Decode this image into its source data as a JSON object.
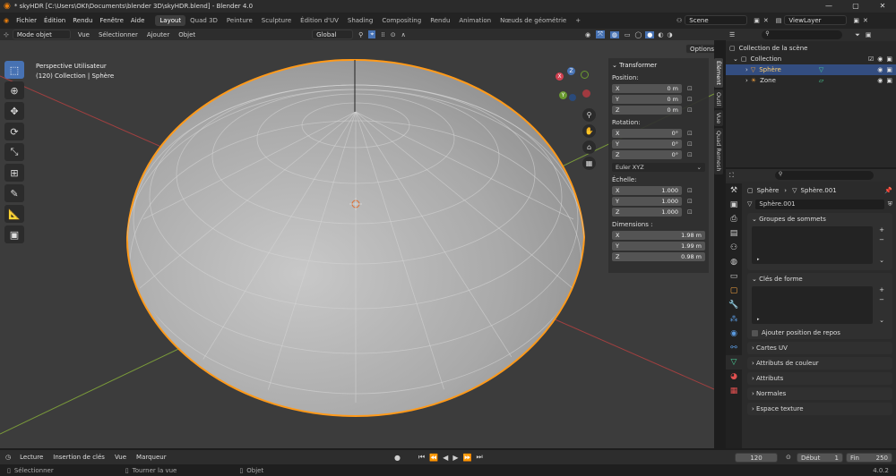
{
  "title_bar": {
    "title": "* skyHDR [C:\\Users\\OKI\\Documents\\blender 3D\\skyHDR.blend] - Blender 4.0",
    "minimize": "—",
    "maximize": "▢",
    "close": "✕"
  },
  "menu": {
    "items": [
      "Fichier",
      "Édition",
      "Rendu",
      "Fenêtre",
      "Aide"
    ],
    "workspaces": [
      "Layout",
      "Quad 3D",
      "Peinture",
      "Sculpture",
      "Édition d'UV",
      "Shading",
      "Compositing",
      "Rendu",
      "Animation",
      "Nœuds de géométrie"
    ],
    "add_tab": "+",
    "scene": "Scene",
    "view_layer": "ViewLayer"
  },
  "viewport_header": {
    "mode": "Mode objet",
    "view": "Vue",
    "select": "Sélectionner",
    "add": "Ajouter",
    "object": "Objet",
    "transform_orientation": "Global",
    "options": "Options"
  },
  "viewport": {
    "perspective": "Perspective Utilisateur",
    "collection_info": "(120) Collection | Sphère"
  },
  "gizmo": {
    "x": "X",
    "y": "Y",
    "z": "Z"
  },
  "npanel": {
    "header": "Transformer",
    "position_label": "Position:",
    "position": [
      {
        "axis": "X",
        "value": "0 m"
      },
      {
        "axis": "Y",
        "value": "0 m"
      },
      {
        "axis": "Z",
        "value": "0 m"
      }
    ],
    "rotation_label": "Rotation:",
    "rotation": [
      {
        "axis": "X",
        "value": "0°"
      },
      {
        "axis": "Y",
        "value": "0°"
      },
      {
        "axis": "Z",
        "value": "0°"
      }
    ],
    "rotation_mode": "Euler XYZ",
    "scale_label": "Échelle:",
    "scale": [
      {
        "axis": "X",
        "value": "1.000"
      },
      {
        "axis": "Y",
        "value": "1.000"
      },
      {
        "axis": "Z",
        "value": "1.000"
      }
    ],
    "dimensions_label": "Dimensions :",
    "dimensions": [
      {
        "axis": "X",
        "value": "1.98 m"
      },
      {
        "axis": "Y",
        "value": "1.99 m"
      },
      {
        "axis": "Z",
        "value": "0.98 m"
      }
    ]
  },
  "side_tabs": [
    "Élément",
    "Outil",
    "Vue",
    "Quad Remesh"
  ],
  "outliner": {
    "root": "Collection de la scène",
    "collection": "Collection",
    "items": [
      "Sphère",
      "Zone"
    ]
  },
  "properties": {
    "object": "Sphère",
    "mesh": "Sphère.001",
    "mesh_field": "Sphère.001",
    "sections": {
      "vertex_groups": "Groupes de sommets",
      "shape_keys": "Clés de forme",
      "add_rest_position": "Ajouter position de repos",
      "uv_maps": "Cartes UV",
      "color_attributes": "Attributs de couleur",
      "attributes": "Attributs",
      "normals": "Normales",
      "texture_space": "Espace texture"
    }
  },
  "timeline": {
    "playback": "Lecture",
    "keying": "Insertion de clés",
    "view": "Vue",
    "markers": "Marqueur",
    "current_frame": "120",
    "start_label": "Début",
    "start": "1",
    "end_label": "Fin",
    "end": "250"
  },
  "status": {
    "select": "Sélectionner",
    "rotate_view": "Tourner la vue",
    "object": "Objet",
    "version": "4.0.2"
  }
}
